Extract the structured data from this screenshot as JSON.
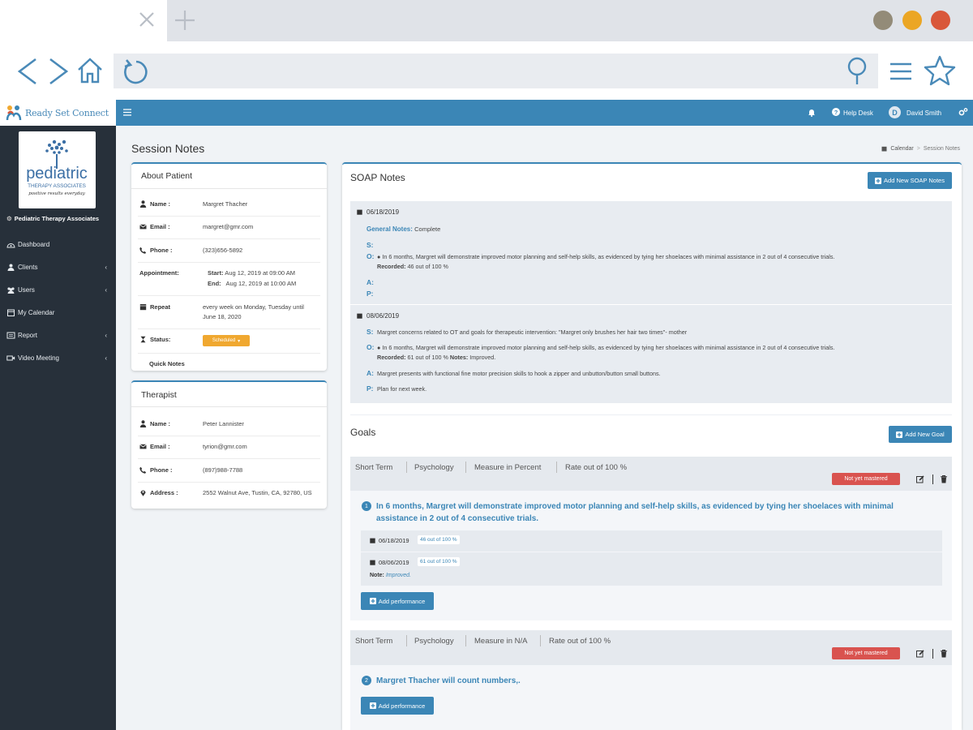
{
  "browser": {
    "window_dot_colors": [
      "#938b78",
      "#eba624",
      "#d9573a"
    ]
  },
  "app": {
    "logo_text": "Ready Set Connect",
    "header": {
      "help_desk": "Help Desk",
      "user_initial": "D",
      "user_name": "David Smith"
    },
    "colors": {
      "primary": "#3b86b6",
      "sidebar": "#27303a",
      "danger": "#d9534f",
      "warning": "#f0a830"
    }
  },
  "sidebar": {
    "org_logo_text": "pediatric",
    "org_logo_sub": "THERAPY ASSOCIATES",
    "org_logo_tagline": "positive results everyday",
    "org_name": "Pediatric Therapy Associates",
    "items": [
      {
        "label": "Dashboard",
        "icon": "palette-icon"
      },
      {
        "label": "Clients",
        "icon": "user-tie-icon"
      },
      {
        "label": "Users",
        "icon": "users-icon"
      },
      {
        "label": "My Calendar",
        "icon": "calendar-icon"
      },
      {
        "label": "Report",
        "icon": "report-icon"
      },
      {
        "label": "Video Meeting",
        "icon": "video-icon"
      }
    ]
  },
  "page": {
    "title": "Session Notes",
    "breadcrumb": [
      "Calendar",
      "Session Notes"
    ]
  },
  "about_patient": {
    "title": "About Patient",
    "name_label": "Name :",
    "name": "Margret Thacher",
    "email_label": "Email :",
    "email": "margret@gmr.com",
    "phone_label": "Phone :",
    "phone": "(323)656-5892",
    "appointment_label": "Appointment:",
    "start_label": "Start:",
    "start": "Aug 12, 2019 at 09:00 AM",
    "end_label": "End:",
    "end": "Aug 12, 2019 at 10:00 AM",
    "repeat_label": "Repeat",
    "repeat_line1": "every week on Monday, Tuesday until",
    "repeat_line2": "June 18, 2020",
    "status_label": "Status:",
    "status_value": "Scheduled",
    "quick_notes": "Quick Notes"
  },
  "therapist": {
    "title": "Therapist",
    "name_label": "Name :",
    "name": "Peter Lannister",
    "email_label": "Email :",
    "email": "tyrion@gmr.com",
    "phone_label": "Phone :",
    "phone": "(897)988-7788",
    "address_label": "Address :",
    "address": "2552 Walnut Ave, Tustin, CA, 92780, US"
  },
  "soap": {
    "title": "SOAP Notes",
    "add_button": "Add New SOAP Notes",
    "entries": [
      {
        "date": "06/18/2019",
        "general_label": "General Notes:",
        "general_value": "Complete",
        "s": "",
        "o_text": "● In 6 months, Margret will demonstrate improved motor planning and self-help skills, as evidenced by tying her shoelaces with minimal assistance in 2 out of 4 consecutive trials.",
        "o_recorded_label": "Recorded:",
        "o_recorded": "46 out of 100 %",
        "a": "",
        "p": ""
      },
      {
        "date": "08/06/2019",
        "s": "Margret concerns related to OT and goals for therapeutic intervention: \"Margret only brushes her hair two times\"- mother",
        "o_text": "● In 6 months, Margret will demonstrate improved motor planning and self-help skills, as evidenced by tying her shoelaces with minimal assistance in 2 out of 4 consecutive trials.",
        "o_recorded_label": "Recorded:",
        "o_recorded": "61 out of 100 %",
        "o_notes_label": "Notes:",
        "o_notes": "Improved.",
        "a": "Margret presents with functional fine motor precision skills to hook a zipper and unbutton/button small buttons.",
        "p": "Plan for next week."
      }
    ],
    "letters": {
      "s": "S:",
      "o": "O:",
      "a": "A:",
      "p": "P:"
    }
  },
  "goals": {
    "title": "Goals",
    "add_button": "Add New Goal",
    "add_performance": "Add performance",
    "items": [
      {
        "term": "Short Term",
        "category": "Psychology",
        "measure": "Measure in Percent",
        "rate": "Rate out of 100 %",
        "status": "Not yet mastered",
        "number": "1",
        "text_line1": "In 6 months, Margret will demonstrate improved motor planning and self-help skills, as evidenced by tying her shoelaces with minimal",
        "text_line2": "assistance in 2 out of 4 consecutive trials.",
        "performances": [
          {
            "date": "06/18/2019",
            "value": "46 out of 100 %"
          },
          {
            "date": "08/06/2019",
            "value": "61 out of 100 %",
            "note_label": "Note:",
            "note": "Improved."
          }
        ]
      },
      {
        "term": "Short Term",
        "category": "Psychology",
        "measure": "Measure in N/A",
        "rate": "Rate out of 100 %",
        "status": "Not yet mastered",
        "number": "2",
        "text_line1": "Margret Thacher will count numbers,."
      }
    ]
  }
}
